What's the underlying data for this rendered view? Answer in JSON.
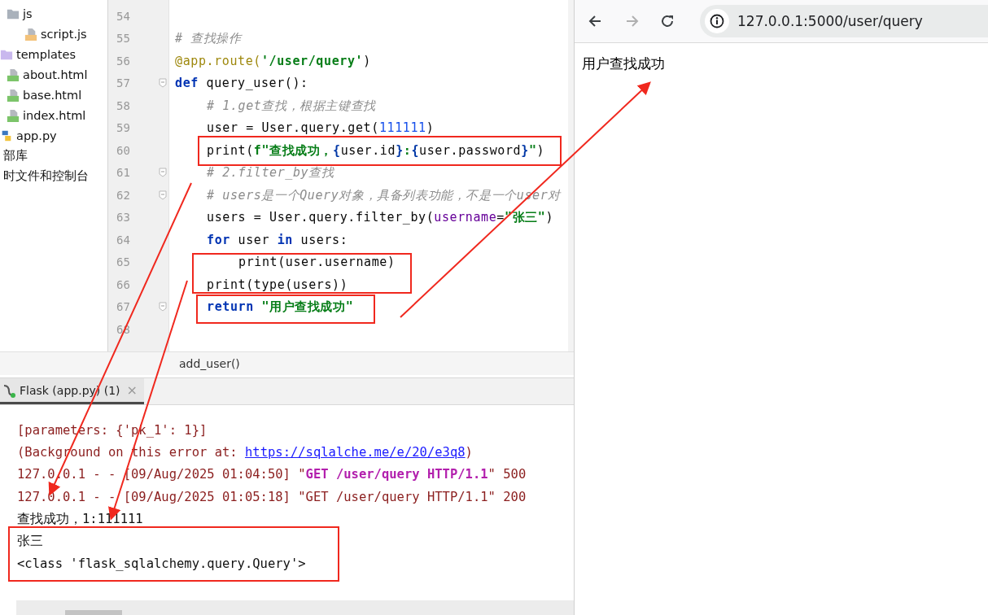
{
  "project_tree": [
    {
      "children": [
        {
          "label": "js",
          "kind": "folder",
          "children": [
            {
              "label": "script.js",
              "kind": "js"
            }
          ]
        }
      ]
    },
    {
      "label": "templates",
      "kind": "template_folder",
      "children": [
        {
          "label": "about.html",
          "kind": "html"
        },
        {
          "label": "base.html",
          "kind": "html"
        },
        {
          "label": "index.html",
          "kind": "html"
        }
      ]
    },
    {
      "label": "app.py",
      "kind": "python"
    },
    {
      "label": "部库",
      "kind": "library"
    },
    {
      "label": "时文件和控制台",
      "kind": "scratch"
    }
  ],
  "editor": {
    "lines": [
      {
        "number": "54",
        "fold": false
      },
      {
        "number": "55",
        "fold": false,
        "segments": [
          {
            "text": "# 查找操作",
            "kind": "comment"
          }
        ]
      },
      {
        "number": "56",
        "fold": false,
        "segments": [
          {
            "text": "@app.route(",
            "kind": "decorator"
          },
          {
            "text": "'/user/query'",
            "kind": "string"
          },
          {
            "text": ")",
            "kind": "plain"
          }
        ]
      },
      {
        "number": "57",
        "fold": true,
        "segments": [
          {
            "text": "def",
            "kind": "keyword"
          },
          {
            "text": " query_user():",
            "kind": "plain"
          }
        ],
        "children": [
          {
            "number": "58",
            "fold": false,
            "segments": [
              {
                "text": "# 1.get查找，根据主键查找",
                "kind": "comment"
              }
            ]
          },
          {
            "number": "59",
            "fold": false,
            "segments": [
              {
                "text": "user = User.query.get(",
                "kind": "plain"
              },
              {
                "text": "111111",
                "kind": "number"
              },
              {
                "text": ")",
                "kind": "plain"
              }
            ]
          },
          {
            "number": "60",
            "fold": false,
            "segments": [
              {
                "text": "print(",
                "kind": "plain"
              },
              {
                "text": "f\"查找成功，",
                "kind": "string"
              },
              {
                "text": "{",
                "kind": "brace"
              },
              {
                "text": "user.id",
                "kind": "plain"
              },
              {
                "text": "}",
                "kind": "brace"
              },
              {
                "text": ":",
                "kind": "string"
              },
              {
                "text": "{",
                "kind": "brace"
              },
              {
                "text": "user.password",
                "kind": "plain"
              },
              {
                "text": "}",
                "kind": "brace"
              },
              {
                "text": "\"",
                "kind": "string"
              },
              {
                "text": ")",
                "kind": "plain"
              }
            ]
          },
          {
            "number": "61",
            "fold": true,
            "segments": [
              {
                "text": "# 2.filter_by查找",
                "kind": "comment"
              }
            ]
          },
          {
            "number": "62",
            "fold": true,
            "segments": [
              {
                "text": "# users是一个Query对象，具备列表功能，不是一个user对",
                "kind": "comment"
              }
            ]
          },
          {
            "number": "63",
            "fold": false,
            "segments": [
              {
                "text": "users = User.query.filter_by(",
                "kind": "plain"
              },
              {
                "text": "username",
                "kind": "param"
              },
              {
                "text": "=",
                "kind": "plain"
              },
              {
                "text": "\"张三\"",
                "kind": "string"
              },
              {
                "text": ")",
                "kind": "plain"
              }
            ]
          },
          {
            "number": "64",
            "fold": false,
            "segments": [
              {
                "text": "for",
                "kind": "keyword"
              },
              {
                "text": " user ",
                "kind": "plain"
              },
              {
                "text": "in",
                "kind": "keyword"
              },
              {
                "text": " users:",
                "kind": "plain"
              }
            ],
            "children": [
              {
                "number": "65",
                "fold": false,
                "segments": [
                  {
                    "text": "print(user.username)",
                    "kind": "plain"
                  }
                ]
              }
            ]
          },
          {
            "number": "66",
            "fold": false,
            "segments": [
              {
                "text": "print(type(users))",
                "kind": "plain"
              }
            ]
          },
          {
            "number": "67",
            "fold": true,
            "segments": [
              {
                "text": "return",
                "kind": "keyword"
              },
              {
                "text": " \"用户查找成功\"",
                "kind": "string"
              }
            ]
          }
        ]
      },
      {
        "number": "68",
        "fold": false
      }
    ],
    "breadcrumb": "add_user()"
  },
  "run_tabs": [
    {
      "label": "Flask (app.py) (1)",
      "close": "×",
      "selected": true
    }
  ],
  "console": [
    [
      {
        "text": "[parameters: {'pk_1': 1}]",
        "kind": "error"
      }
    ],
    [
      {
        "text": "(Background on this error at: ",
        "kind": "error"
      },
      {
        "text": "https://sqlalche.me/e/20/e3q8",
        "kind": "link"
      },
      {
        "text": ")",
        "kind": "error"
      }
    ],
    [
      {
        "text": "127.0.0.1 - - [09/Aug/2025 01:04:50] \"",
        "kind": "error"
      },
      {
        "text": "GET /user/query HTTP/1.1",
        "kind": "request"
      },
      {
        "text": "\" 500",
        "kind": "error"
      }
    ],
    [
      {
        "text": "127.0.0.1 - - [09/Aug/2025 01:05:18] \"GET /user/query HTTP/1.1\" 200",
        "kind": "error"
      }
    ],
    [
      {
        "text": "查找成功，1:111111",
        "kind": "output"
      }
    ],
    [
      {
        "text": "张三",
        "kind": "output"
      }
    ],
    [
      {
        "text": "<class 'flask_sqlalchemy.query.Query'>",
        "kind": "output"
      }
    ]
  ],
  "browser": {
    "back_enabled": true,
    "forward_enabled": false,
    "url": "127.0.0.1:5000/user/query",
    "content": "用户查找成功"
  }
}
